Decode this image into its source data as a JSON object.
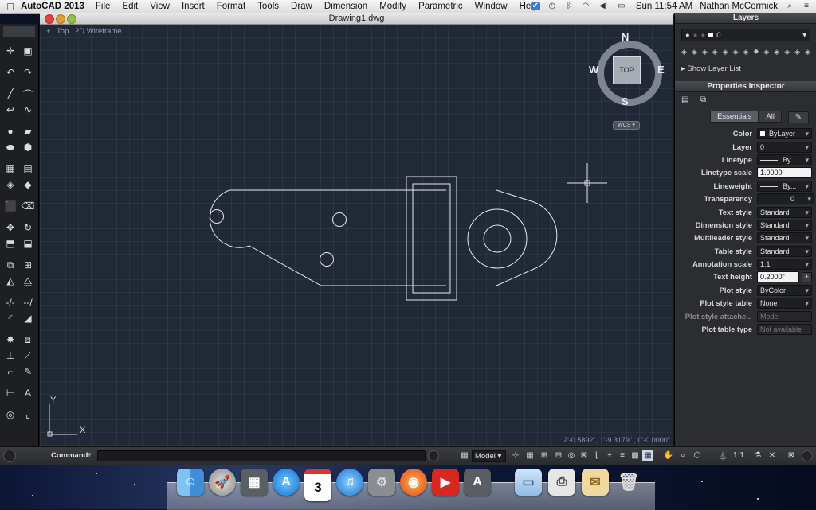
{
  "menubar": {
    "app_name": "AutoCAD 2013",
    "items": [
      "File",
      "Edit",
      "View",
      "Insert",
      "Format",
      "Tools",
      "Draw",
      "Dimension",
      "Modify",
      "Parametric",
      "Window",
      "Help"
    ],
    "clock": "Sun 11:54 AM",
    "user": "Nathan McCormick"
  },
  "window": {
    "title": "Drawing1.dwg",
    "view_labels": [
      "Top",
      "2D Wireframe"
    ]
  },
  "viewcube": {
    "n": "N",
    "s": "S",
    "e": "E",
    "w": "W",
    "face": "TOP",
    "wcs": "WCS"
  },
  "ucs": {
    "x": "X",
    "y": "Y"
  },
  "status": {
    "coords": "2'-0.5892\",  1'-9.3179\" , 0'-0.0000\""
  },
  "layers": {
    "title": "Layers",
    "current": "0",
    "show_list": "Show Layer List"
  },
  "properties": {
    "title": "Properties Inspector",
    "tabs": [
      "Essentials",
      "All"
    ],
    "rows": [
      {
        "label": "Color",
        "value": "ByLayer"
      },
      {
        "label": "Layer",
        "value": "0"
      },
      {
        "label": "Linetype",
        "value": "By..."
      },
      {
        "label": "Linetype scale",
        "value": "1.0000"
      },
      {
        "label": "Lineweight",
        "value": "By..."
      },
      {
        "label": "Transparency",
        "value": "0"
      },
      {
        "label": "Text style",
        "value": "Standard"
      },
      {
        "label": "Dimension style",
        "value": "Standard"
      },
      {
        "label": "Multileader style",
        "value": "Standard"
      },
      {
        "label": "Table style",
        "value": "Standard"
      },
      {
        "label": "Annotation scale",
        "value": "1:1"
      },
      {
        "label": "Text height",
        "value": "0.2000\""
      },
      {
        "label": "Plot style",
        "value": "ByColor"
      },
      {
        "label": "Plot style table",
        "value": "None"
      },
      {
        "label": "Plot style attache...",
        "value": "Model"
      },
      {
        "label": "Plot table type",
        "value": "Not available"
      }
    ]
  },
  "command": {
    "label": "Command:"
  },
  "statusbar": {
    "model": "Model",
    "scale": "1:1"
  },
  "dock": {
    "calendar_day": "3"
  }
}
